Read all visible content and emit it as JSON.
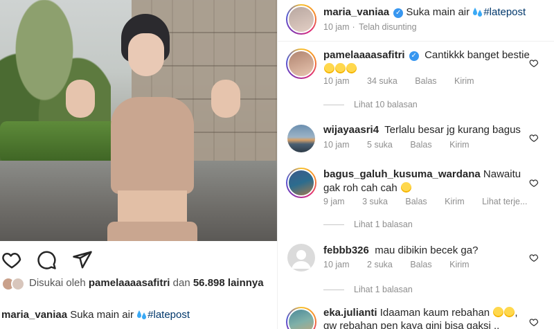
{
  "post": {
    "username": "maria_vaniaa",
    "caption_text": "Suka main air",
    "hashtag": "#latepost",
    "time": "10 jam",
    "edited": "Telah disunting"
  },
  "likes": {
    "prefix": "Disukai oleh",
    "user": "pamelaaaasafitri",
    "conj": "dan",
    "count": "56.898",
    "suffix": "lainnya"
  },
  "comments": [
    {
      "user": "pamelaaaasafitri",
      "verified": true,
      "text": "Cantikkk banget bestie",
      "time": "10 jam",
      "likes": "34 suka",
      "reply": "Balas",
      "send": "Kirim",
      "view_replies": "Lihat 10 balasan"
    },
    {
      "user": "wijayaasri4",
      "verified": false,
      "text": "Terlalu besar jg kurang bagus",
      "time": "10 jam",
      "likes": "5 suka",
      "reply": "Balas",
      "send": "Kirim"
    },
    {
      "user": "bagus_galuh_kusuma_wardana",
      "verified": false,
      "text": "Nawaitu gak roh cah cah",
      "time": "9 jam",
      "likes": "3 suka",
      "reply": "Balas",
      "send": "Kirim",
      "translate": "Lihat terje...",
      "view_replies": "Lihat 1 balasan"
    },
    {
      "user": "febbb326",
      "verified": false,
      "text": "mau dibikin becek ga?",
      "time": "10 jam",
      "likes": "2 suka",
      "reply": "Balas",
      "send": "Kirim",
      "view_replies": "Lihat 1 balasan"
    },
    {
      "user": "eka.julianti",
      "verified": false,
      "text": "Idaaman kaum rebahan",
      "text2": "gw rebahan pen kaya gini bisa gaksi .."
    }
  ],
  "colors": {
    "verified": "#3897f0",
    "link": "#00376b",
    "muted": "#8e8e8e"
  },
  "icons": [
    "heart-icon",
    "comment-icon",
    "share-icon",
    "verified-icon",
    "small-heart-icon"
  ]
}
